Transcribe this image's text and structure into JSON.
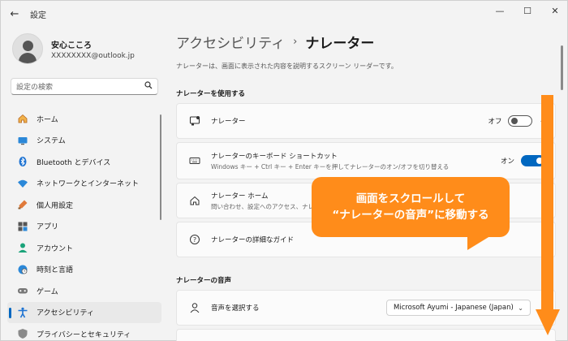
{
  "window": {
    "app_title": "設定",
    "back_icon": "←",
    "minimize_icon": "—",
    "maximize_icon": "☐",
    "close_icon": "✕"
  },
  "profile": {
    "name": "安心こころ",
    "email": "XXXXXXXX@outlook.jp"
  },
  "search": {
    "placeholder": "設定の検索"
  },
  "sidebar": {
    "items": [
      {
        "label": "ホーム",
        "icon": "home-icon",
        "active": false
      },
      {
        "label": "システム",
        "icon": "system-icon",
        "active": false
      },
      {
        "label": "Bluetooth とデバイス",
        "icon": "bluetooth-icon",
        "active": false
      },
      {
        "label": "ネットワークとインターネット",
        "icon": "wifi-icon",
        "active": false
      },
      {
        "label": "個人用設定",
        "icon": "brush-icon",
        "active": false
      },
      {
        "label": "アプリ",
        "icon": "apps-icon",
        "active": false
      },
      {
        "label": "アカウント",
        "icon": "account-icon",
        "active": false
      },
      {
        "label": "時刻と言語",
        "icon": "globe-clock-icon",
        "active": false
      },
      {
        "label": "ゲーム",
        "icon": "gamepad-icon",
        "active": false
      },
      {
        "label": "アクセシビリティ",
        "icon": "accessibility-icon",
        "active": true
      },
      {
        "label": "プライバシーとセキュリティ",
        "icon": "shield-icon",
        "active": false
      }
    ]
  },
  "main": {
    "breadcrumb_parent": "アクセシビリティ",
    "breadcrumb_separator": "›",
    "breadcrumb_current": "ナレーター",
    "description": "ナレーターは、画面に表示された内容を説明するスクリーン リーダーです。",
    "section_use": "ナレーターを使用する",
    "section_voice": "ナレーターの音声",
    "cards": {
      "narrator": {
        "title": "ナレーター",
        "toggle_label": "オフ",
        "state": "off"
      },
      "shortcut": {
        "title": "ナレーターのキーボード ショートカット",
        "subtitle": "Windows キー + Ctrl キー + Enter キーを押してナレーターのオン/オフを切り替える",
        "toggle_label": "オン",
        "state": "on"
      },
      "home": {
        "title": "ナレーター ホーム",
        "subtitle": "問い合わせ、設定へのアクセス、ナレーター"
      },
      "guide": {
        "title": "ナレーターの詳細なガイド"
      },
      "voice": {
        "title": "音声を選択する",
        "value": "Microsoft Ayumi - Japanese (Japan)"
      }
    }
  },
  "callout": {
    "line1": "画面をスクロールして",
    "line2": "“ナレーターの音声”に移動する",
    "color": "#ff8c1a"
  },
  "colors": {
    "accent": "#0067c0",
    "annotation": "#ff8c1a"
  }
}
